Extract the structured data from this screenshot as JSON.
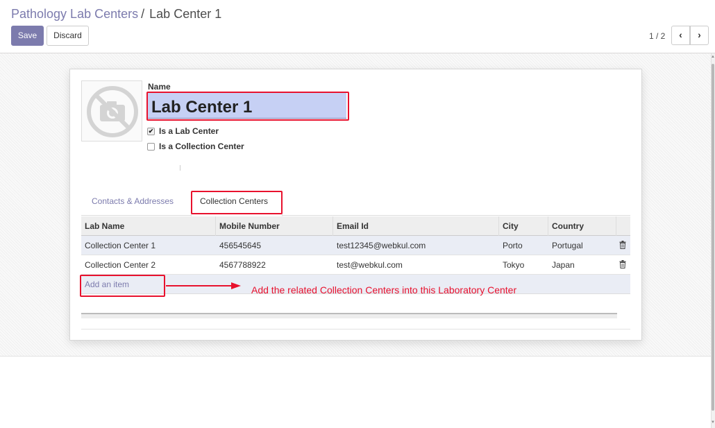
{
  "breadcrumb": {
    "parent": "Pathology Lab Centers",
    "separator": "/",
    "current": "Lab Center 1"
  },
  "buttons": {
    "save": "Save",
    "discard": "Discard"
  },
  "pager": {
    "value": "1 / 2",
    "prev_icon": "chevron-left-icon",
    "next_icon": "chevron-right-icon"
  },
  "form": {
    "name_label": "Name",
    "name_value": "Lab Center 1",
    "is_lab_center": {
      "label": "Is a Lab Center",
      "checked": true
    },
    "is_collection_center": {
      "label": "Is a Collection Center",
      "checked": false
    },
    "avatar_icon": "camera-placeholder-icon"
  },
  "tabs": [
    {
      "label": "Contacts & Addresses",
      "active": false
    },
    {
      "label": "Collection Centers",
      "active": true
    }
  ],
  "table": {
    "columns": [
      "Lab Name",
      "Mobile Number",
      "Email Id",
      "City",
      "Country"
    ],
    "rows": [
      [
        "Collection Center 1",
        "456545645",
        "test12345@webkul.com",
        "Porto",
        "Portugal"
      ],
      [
        "Collection Center 2",
        "4567788922",
        "test@webkul.com",
        "Tokyo",
        "Japan"
      ]
    ],
    "row_action_icon": "trash-icon",
    "add_item": "Add an item"
  },
  "annotation": "Add the related Collection Centers into this Laboratory Center",
  "colors": {
    "primary": "#7c7bad",
    "highlight": "#e8112d",
    "name_field_bg": "#c6d0f4"
  }
}
